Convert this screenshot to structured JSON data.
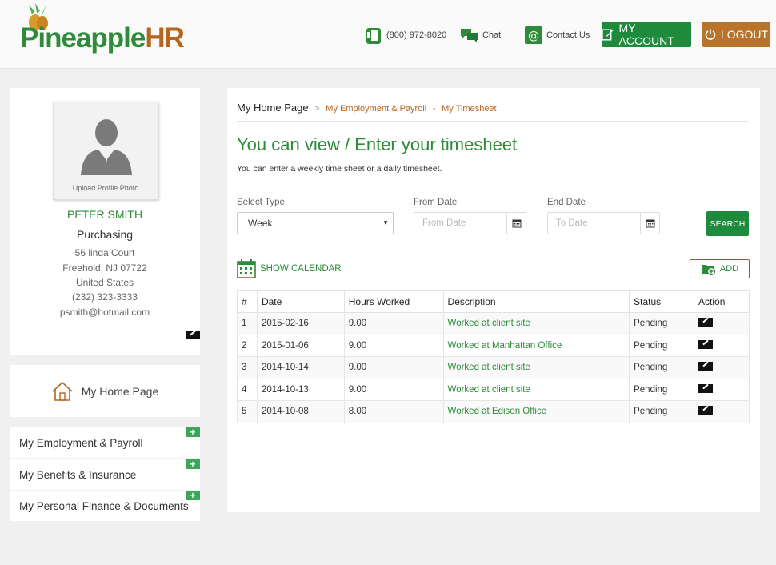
{
  "header": {
    "logo_part1": "Pineapple",
    "logo_part2": "HR",
    "phone": "(800) 972-8020",
    "chat": "Chat",
    "contact": "Contact Us",
    "account_label": "MY ACCOUNT",
    "logout_label": "LOGOUT"
  },
  "profile": {
    "photo_label": "Upload Profile Photo",
    "name": "PETER SMITH",
    "department": "Purchasing",
    "address1": "56 linda Court",
    "address2": "Freehold, NJ 07722",
    "country": "United States",
    "phone": "(232) 323-3333",
    "email": "psmith@hotmail.com"
  },
  "sidebar": {
    "home_label": "My Home Page",
    "items": [
      {
        "label": "My Employment & Payroll"
      },
      {
        "label": "My Benefits & Insurance"
      },
      {
        "label": "My Personal Finance & Documents"
      }
    ]
  },
  "breadcrumb": {
    "home": "My Home Page",
    "section": "My Employment & Payroll",
    "page": "My Timesheet"
  },
  "main": {
    "title": "You can view / Enter your timesheet",
    "subtitle": "You can enter a weekly time sheet or a daily timesheet."
  },
  "filters": {
    "type_label": "Select Type",
    "type_value": "Week",
    "from_label": "From Date",
    "from_placeholder": "From Date",
    "end_label": "End Date",
    "end_placeholder": "To Date",
    "search_label": "SEARCH"
  },
  "actions": {
    "show_calendar": "SHOW CALENDAR",
    "add": "ADD"
  },
  "table": {
    "headers": [
      "#",
      "Date",
      "Hours Worked",
      "Description",
      "Status",
      "Action"
    ],
    "rows": [
      {
        "num": "1",
        "date": "2015-02-16",
        "hours": "9.00",
        "desc": "Worked at client site",
        "status": "Pending"
      },
      {
        "num": "2",
        "date": "2015-01-06",
        "hours": "9.00",
        "desc": "Worked at Manhattan Office",
        "status": "Pending"
      },
      {
        "num": "3",
        "date": "2014-10-14",
        "hours": "9.00",
        "desc": "Worked at client site",
        "status": "Pending"
      },
      {
        "num": "4",
        "date": "2014-10-13",
        "hours": "9.00",
        "desc": "Worked at client site",
        "status": "Pending"
      },
      {
        "num": "5",
        "date": "2014-10-08",
        "hours": "8.00",
        "desc": "Worked at Edison Office",
        "status": "Pending"
      }
    ]
  },
  "colors": {
    "brand_green": "#2e8b3a",
    "brand_orange": "#b5651d",
    "button_green": "#1e8a3c",
    "logout_orange": "#b8742a"
  }
}
